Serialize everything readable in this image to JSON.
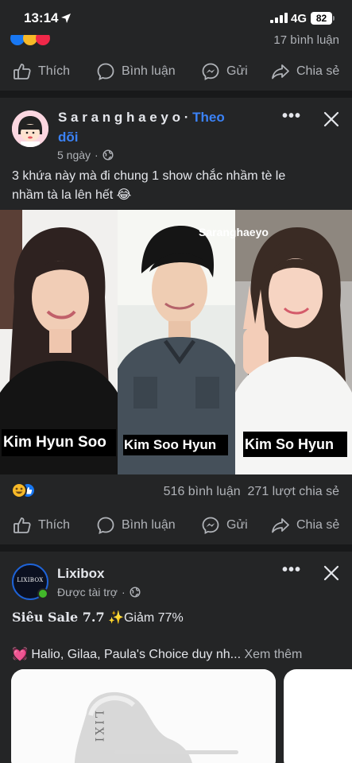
{
  "status_bar": {
    "time": "13:14",
    "network": "4G",
    "battery": "82"
  },
  "previous_post": {
    "comments": "17 bình luận"
  },
  "actions": {
    "like": "Thích",
    "comment": "Bình luận",
    "send": "Gửi",
    "share": "Chia sẻ"
  },
  "post": {
    "author": "S a r a n g h a e y o",
    "separator": "·",
    "follow_line1": "Theo",
    "follow_line2": "dõi",
    "time": "5 ngày",
    "caption_line1": "3 khứa này mà đi chung 1 show chắc nhầm tè le",
    "caption_line2": "nhầm tà la lên hết 😂",
    "image": {
      "watermark": "Saranghaeyo",
      "labels": [
        "Kim Hyun Soo",
        "Kim Soo Hyun",
        "Kim So Hyun"
      ]
    },
    "comments_count": "516 bình luận",
    "shares_count": "271 lượt chia sẻ"
  },
  "ad": {
    "brand": "Lixibox",
    "logo_text": "LIXIBOX",
    "sponsored": "Được tài trợ",
    "headline_bold": "Siêu Sale 7.7",
    "headline_rest": "✨Giảm 77%",
    "body": "💓 Halio, Gilaa, Paula's Choice duy nh...",
    "see_more": "Xem thêm",
    "product_text": "LIXI"
  },
  "colors": {
    "background": "#242526",
    "divider": "#18191a",
    "link": "#3b82f6",
    "secondary_text": "#b0b3b8"
  }
}
